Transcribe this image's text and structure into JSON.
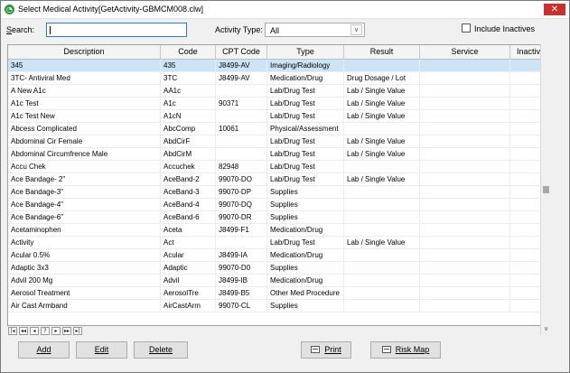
{
  "window": {
    "title": "Select Medical Activity[GetActivity-GBMCM008.clw]",
    "app_icon": "◔",
    "close_glyph": "✕"
  },
  "filters": {
    "search_label": "Search:",
    "search_value": "",
    "activity_type_label": "Activity Type:",
    "activity_type_value": "All",
    "dropdown_glyph": "∨",
    "include_inactives_label": "Include Inactives",
    "include_inactives_checked": false
  },
  "grid": {
    "columns": [
      "Description",
      "Code",
      "CPT Code",
      "Type",
      "Result",
      "Service",
      "Inactive"
    ],
    "rows": [
      [
        "345",
        "435",
        "J8499-AV",
        "Imaging/Radiology",
        "",
        "",
        ""
      ],
      [
        "3TC- Antiviral Med",
        "3TC",
        "J8499-AV",
        "Medication/Drug",
        "Drug Dosage / Lot",
        "",
        ""
      ],
      [
        "A New A1c",
        "AA1c",
        "",
        "Lab/Drug Test",
        "Lab / Single Value",
        "",
        ""
      ],
      [
        "A1c Test",
        "A1c",
        "90371",
        "Lab/Drug Test",
        "Lab / Single Value",
        "",
        ""
      ],
      [
        "A1c Test New",
        "A1cN",
        "",
        "Lab/Drug Test",
        "Lab / Single Value",
        "",
        ""
      ],
      [
        "Abcess Complicated",
        "AbcComp",
        "10061",
        "Physical/Assessment",
        "",
        "",
        ""
      ],
      [
        "Abdominal Cir Female",
        "AbdCirF",
        "",
        "Lab/Drug Test",
        "Lab / Single Value",
        "",
        ""
      ],
      [
        "Abdominal Circumfrence Male",
        "AbdCirM",
        "",
        "Lab/Drug Test",
        "Lab / Single Value",
        "",
        ""
      ],
      [
        "Accu Chek",
        "Accuchek",
        "82948",
        "Lab/Drug Test",
        "",
        "",
        ""
      ],
      [
        "Ace Bandage- 2\"",
        "AceBand-2",
        "99070-DO",
        "Lab/Drug Test",
        "Lab / Single Value",
        "",
        ""
      ],
      [
        "Ace Bandage-3\"",
        "AceBand-3",
        "99070-DP",
        "Supplies",
        "",
        "",
        ""
      ],
      [
        "Ace Bandage-4\"",
        "AceBand-4",
        "99070-DQ",
        "Supplies",
        "",
        "",
        ""
      ],
      [
        "Ace Bandage-6\"",
        "AceBand-6",
        "99070-DR",
        "Supplies",
        "",
        "",
        ""
      ],
      [
        "Acetaminophen",
        "Aceta",
        "J8499-F1",
        "Medication/Drug",
        "",
        "",
        ""
      ],
      [
        "Activity",
        "Act",
        "",
        "Lab/Drug Test",
        "Lab / Single Value",
        "",
        ""
      ],
      [
        "Acular 0.5%",
        "Acular",
        "J8499-IA",
        "Medication/Drug",
        "",
        "",
        ""
      ],
      [
        "Adaptic 3x3",
        "Adaptic",
        "99070-D0",
        "Supplies",
        "",
        "",
        ""
      ],
      [
        "Advil 200 Mg",
        "Advil",
        "J8499-IB",
        "Medication/Drug",
        "",
        "",
        ""
      ],
      [
        "Aerosol Treatment",
        "AerosolTre",
        "J8499-B5",
        "Other Med Procedure",
        "",
        "",
        ""
      ],
      [
        "Air Cast Armband",
        "AirCastArm",
        "99070-CL",
        "Supplies",
        "",
        "",
        ""
      ]
    ],
    "selected_row": 0,
    "nav_buttons": [
      "|◂",
      "◂◂",
      "◂",
      "?",
      "▸",
      "▸▸",
      "▸|"
    ],
    "scroll_down_glyph": "∨"
  },
  "buttons": {
    "add": "Add",
    "edit": "Edit",
    "delete": "Delete",
    "print": "Print",
    "risk_map": "Risk Map"
  },
  "colors": {
    "selection": "#cce4f7",
    "close_button": "#c7302b",
    "focus_border": "#2b7ad4"
  }
}
